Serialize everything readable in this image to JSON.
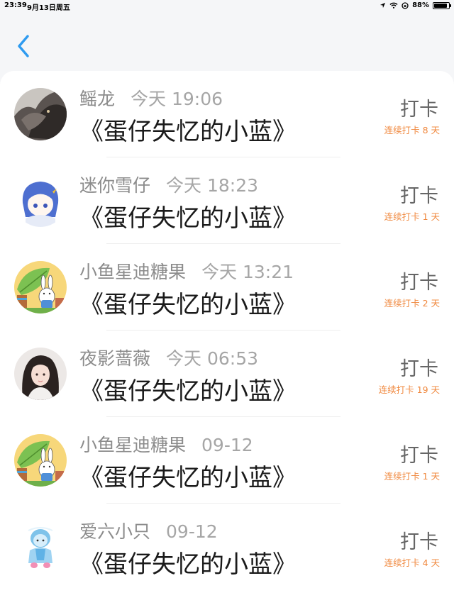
{
  "status_bar": {
    "time": "23:39",
    "date": "9月13日周五",
    "battery": "88%",
    "battery_level": 0.88
  },
  "nav": {
    "back_icon": "chevron-left-icon",
    "accent_color": "#2e9bf0"
  },
  "records": [
    {
      "user": "鳐龙",
      "time": "今天 19:06",
      "title": "《蛋仔失忆的小蓝》",
      "action": "打卡",
      "streak": "连续打卡 8 天",
      "avatar": "dragon"
    },
    {
      "user": "迷你雪仔",
      "time": "今天 18:23",
      "title": "《蛋仔失忆的小蓝》",
      "action": "打卡",
      "streak": "连续打卡 1 天",
      "avatar": "anime-girl"
    },
    {
      "user": "小鱼星迪糖果",
      "time": "今天 13:21",
      "title": "《蛋仔失忆的小蓝》",
      "action": "打卡",
      "streak": "连续打卡 2 天",
      "avatar": "bunny-leaf"
    },
    {
      "user": "夜影蔷薇",
      "time": "今天 06:53",
      "title": "《蛋仔失忆的小蓝》",
      "action": "打卡",
      "streak": "连续打卡 19 天",
      "avatar": "photo-girl"
    },
    {
      "user": "小鱼星迪糖果",
      "time": "09-12",
      "title": "《蛋仔失忆的小蓝》",
      "action": "打卡",
      "streak": "连续打卡 1 天",
      "avatar": "bunny-leaf"
    },
    {
      "user": "爱六小只",
      "time": "09-12",
      "title": "《蛋仔失忆的小蓝》",
      "action": "打卡",
      "streak": "连续打卡 4 天",
      "avatar": "blue-doll"
    }
  ]
}
